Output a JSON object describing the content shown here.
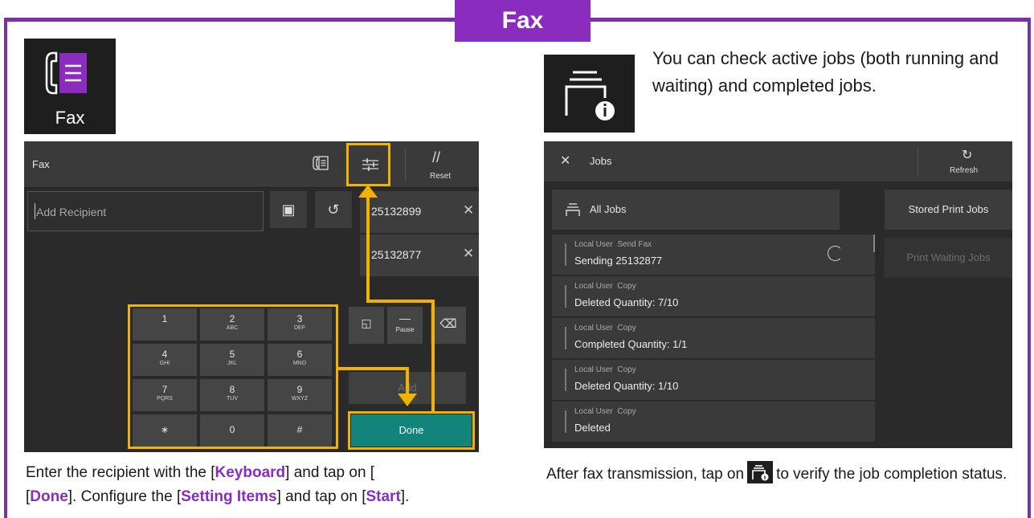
{
  "header": {
    "title": "Fax"
  },
  "fax_app_tile": {
    "label": "Fax"
  },
  "left_screen": {
    "title": "Fax",
    "reset_label": "Reset",
    "recipient_placeholder": "Add Recipient",
    "recipients": [
      {
        "number": "25132899"
      },
      {
        "number": "25132877"
      }
    ],
    "keypad": [
      {
        "main": "1",
        "sub": ""
      },
      {
        "main": "2",
        "sub": "ABC"
      },
      {
        "main": "3",
        "sub": "DEF"
      },
      {
        "main": "4",
        "sub": "GHI"
      },
      {
        "main": "5",
        "sub": "JKL"
      },
      {
        "main": "6",
        "sub": "MNO"
      },
      {
        "main": "7",
        "sub": "PQRS"
      },
      {
        "main": "8",
        "sub": "TUV"
      },
      {
        "main": "9",
        "sub": "WXYZ"
      },
      {
        "main": "∗",
        "sub": ""
      },
      {
        "main": "0",
        "sub": ""
      },
      {
        "main": "#",
        "sub": ""
      }
    ],
    "pause_label": "Pause",
    "add_label": "Add",
    "done_label": "Done"
  },
  "right_description": "You can check active jobs (both running and waiting) and completed jobs.",
  "right_screen": {
    "title": "Jobs",
    "refresh_label": "Refresh",
    "all_jobs_label": "All Jobs",
    "stored_print_jobs_label": "Stored Print Jobs",
    "print_waiting_jobs_label": "Print Waiting Jobs",
    "jobs": [
      {
        "user": "Local User",
        "type": "Send Fax",
        "status": "Sending  25132877"
      },
      {
        "user": "Local User",
        "type": "Copy",
        "status": "Deleted  Quantity: 7/10"
      },
      {
        "user": "Local User",
        "type": "Copy",
        "status": "Completed  Quantity: 1/1"
      },
      {
        "user": "Local User",
        "type": "Copy",
        "status": "Deleted  Quantity: 1/10"
      },
      {
        "user": "Local User",
        "type": "Copy",
        "status": "Deleted"
      }
    ]
  },
  "caption_left": {
    "part1": "Enter the recipient with the [",
    "keyboard": "Keyboard",
    "part2": "] and tap on [",
    "done": "Done",
    "part3": "]. Configure the [",
    "setting_items": "Setting Items",
    "part4": "] and tap on [",
    "start": "Start",
    "part5": "]."
  },
  "caption_right": {
    "part1": "After fax transmission, tap on",
    "part2": "to verify the job completion status."
  },
  "colors": {
    "accent": "#8a2cbd",
    "highlight": "#f1b300",
    "done": "#13847a"
  }
}
